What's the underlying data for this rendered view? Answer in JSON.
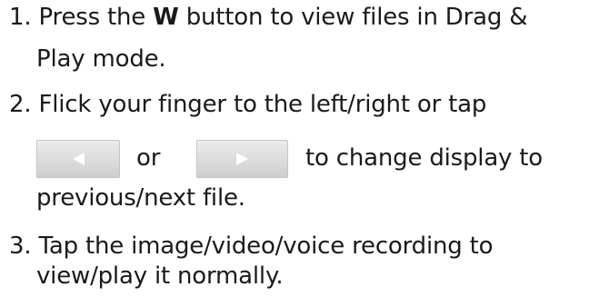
{
  "instructions": {
    "step1": {
      "number": "1.",
      "text_before": "Press the",
      "bold_key": "W",
      "text_after": "button to view files in Drag &",
      "continuation": "Play mode."
    },
    "step2": {
      "number": "2.",
      "text": "Flick your finger to the left/right or tap",
      "or_word": "or",
      "after_buttons": "to change display to",
      "continuation": "previous/next file."
    },
    "step3": {
      "number": "3.",
      "text": "Tap the image/video/voice recording to",
      "continuation": "view/play it normally."
    }
  },
  "buttons": {
    "previous_icon": "triangle-left-icon",
    "next_icon": "triangle-right-icon",
    "button_color": "#d9d9d9",
    "icon_color": "#ffffff"
  }
}
